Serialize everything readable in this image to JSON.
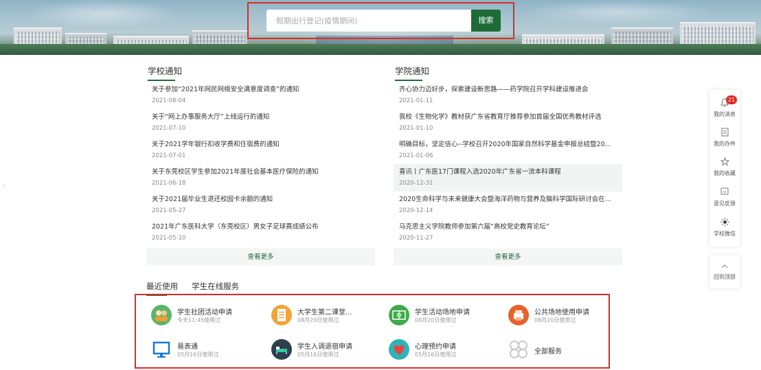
{
  "search": {
    "placeholder": "假期出行登记(疫情期间)",
    "button_label": "搜索"
  },
  "school_notices": {
    "title": "学校通知",
    "items": [
      {
        "title": "关于参加“2021年网民网络安全满意度调查”的通知",
        "date": "2021-08-04"
      },
      {
        "title": "关于“网上办事服务大厅”上线运行的通知",
        "date": "2021-07-10"
      },
      {
        "title": "关于2021学年银行扣收学费和住宿费的通知",
        "date": "2021-07-01"
      },
      {
        "title": "关于东莞校区学生参加2021年度社会基本医疗保险的通知",
        "date": "2021-06-18"
      },
      {
        "title": "关于2021届毕业生退还校园卡余额的通知",
        "date": "2021-05-27"
      },
      {
        "title": "2021年广东医科大学（东莞校区）男女子足球赛成绩公布",
        "date": "2021-05-10"
      }
    ],
    "more_label": "查看更多"
  },
  "college_notices": {
    "title": "学院通知",
    "items": [
      {
        "title": "齐心协力迈好步，探索建设新思路——药学院召开学科建设推进会",
        "date": "2021-01-11"
      },
      {
        "title": "我校《生物化学》教材获广东省教育厅推荐参加首届全国优秀教材评选",
        "date": "2021-01-10"
      },
      {
        "title": "明确目标，坚定信心--学校召开2020年国家自然科学基金申报总结暨20...",
        "date": "2021-01-06"
      },
      {
        "title": "喜讯丨广东医17门课程入选2020年广东省一流本科课程",
        "date": "2020-12-31"
      },
      {
        "title": "2020生命科学与未来健康大会暨海洋药物与营养及脑科学国际研讨会在...",
        "date": "2020-12-14"
      },
      {
        "title": "马克思主义学院教师参加第六届“高校党史教育论坛”",
        "date": "2020-11-27"
      }
    ],
    "more_label": "查看更多"
  },
  "services": {
    "tabs": [
      "最近使用",
      "学生在线服务"
    ],
    "items": [
      {
        "name": "学生社团活动申请",
        "used": "今天11:45使用过",
        "color": "#5bb56a"
      },
      {
        "name": "大学生第二课堂...",
        "used": "08月20日使用过",
        "color": "#f0a53a"
      },
      {
        "name": "学生活动场地申请",
        "used": "08月20日使用过",
        "color": "#3faa4b"
      },
      {
        "name": "公共场地使用申请",
        "used": "08月20日使用过",
        "color": "#e8612c"
      },
      {
        "name": "易表通",
        "used": "05月16日使用过",
        "color": "#2b8fd6"
      },
      {
        "name": "学生入调退宿申请",
        "used": "05月16日使用过",
        "color": "#2e3f4f"
      },
      {
        "name": "心理预约申请",
        "used": "05月16日使用过",
        "color": "#2fb3b8"
      },
      {
        "name": "全部服务",
        "used": "",
        "color": "#c8c8c8"
      }
    ]
  },
  "sidebar": {
    "messages": {
      "label": "我的消息",
      "badge": "21"
    },
    "tasks": {
      "label": "我的办件"
    },
    "favorites": {
      "label": "我的收藏"
    },
    "feedback": {
      "label": "意见反馈"
    },
    "wechat": {
      "label": "学校微信"
    },
    "top": {
      "label": "回到顶部"
    }
  },
  "icons": {
    "bell": "bell-icon",
    "doc": "document-icon",
    "star": "star-icon",
    "feedback": "chat-icon",
    "sun": "sun-icon",
    "up": "chevron-up-icon"
  },
  "colors": {
    "accent": "#1d6b36",
    "highlight_border": "#e02a22"
  }
}
